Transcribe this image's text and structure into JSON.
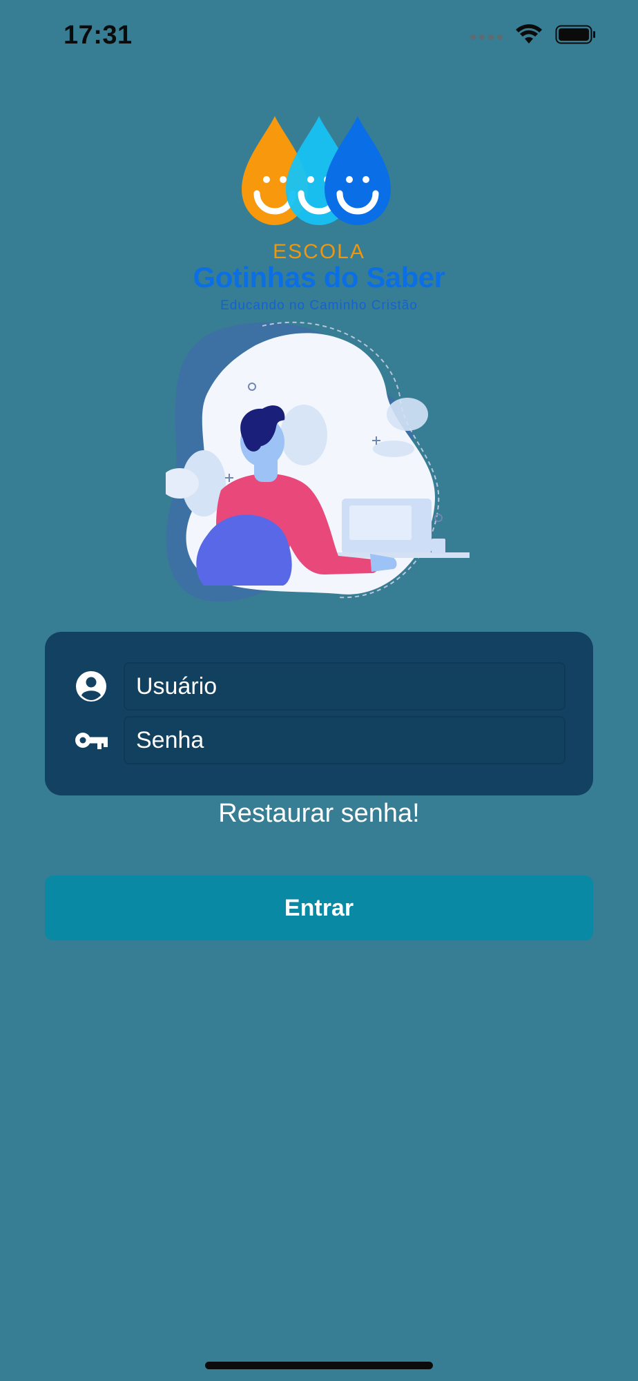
{
  "status_bar": {
    "time": "17:31",
    "signal_icon": "cellular-signal-icon",
    "wifi_icon": "wifi-icon",
    "battery_icon": "battery-icon"
  },
  "logo": {
    "escola": "ESCOLA",
    "name": "Gotinhas do Saber",
    "tagline": "Educando no Caminho Cristão",
    "drop_colors": [
      "#f7980d",
      "#17c2f3",
      "#0a6fe6"
    ]
  },
  "illustration": {
    "icon": "person-at-computer-illustration"
  },
  "login": {
    "user_icon": "user-circle-icon",
    "user_placeholder": "Usuário",
    "password_icon": "key-icon",
    "password_placeholder": "Senha",
    "restore_label": "Restaurar senha!",
    "enter_label": "Entrar"
  },
  "colors": {
    "background": "#377e94",
    "card": "#124162",
    "button": "#0a89a5",
    "logo_orange": "#f1960c",
    "logo_blue": "#0b6fe3"
  }
}
